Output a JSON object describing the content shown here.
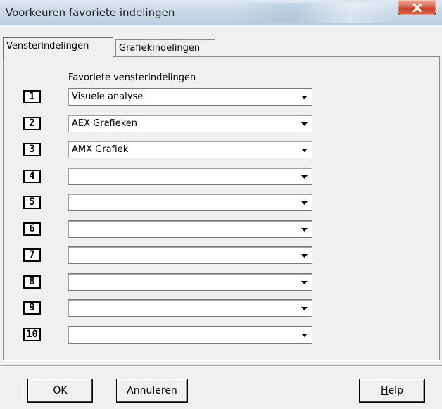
{
  "window": {
    "title": "Voorkeuren favoriete indelingen",
    "close_icon": "close-icon"
  },
  "tabs": [
    {
      "label": "Vensterindelingen",
      "active": true
    },
    {
      "label": "Grafiekindelingen",
      "active": false
    }
  ],
  "panel": {
    "heading": "Favoriete vensterindelingen",
    "slots": [
      {
        "number": "1",
        "value": "Visuele analyse"
      },
      {
        "number": "2",
        "value": "AEX Grafieken"
      },
      {
        "number": "3",
        "value": "AMX Grafiek"
      },
      {
        "number": "4",
        "value": ""
      },
      {
        "number": "5",
        "value": ""
      },
      {
        "number": "6",
        "value": ""
      },
      {
        "number": "7",
        "value": ""
      },
      {
        "number": "8",
        "value": ""
      },
      {
        "number": "9",
        "value": ""
      },
      {
        "number": "10",
        "value": ""
      }
    ]
  },
  "buttons": {
    "ok": "OK",
    "cancel": "Annuleren",
    "help_mnemonic": "H",
    "help_rest": "elp"
  },
  "icons": {
    "dropdown": "chevron-down-icon"
  }
}
